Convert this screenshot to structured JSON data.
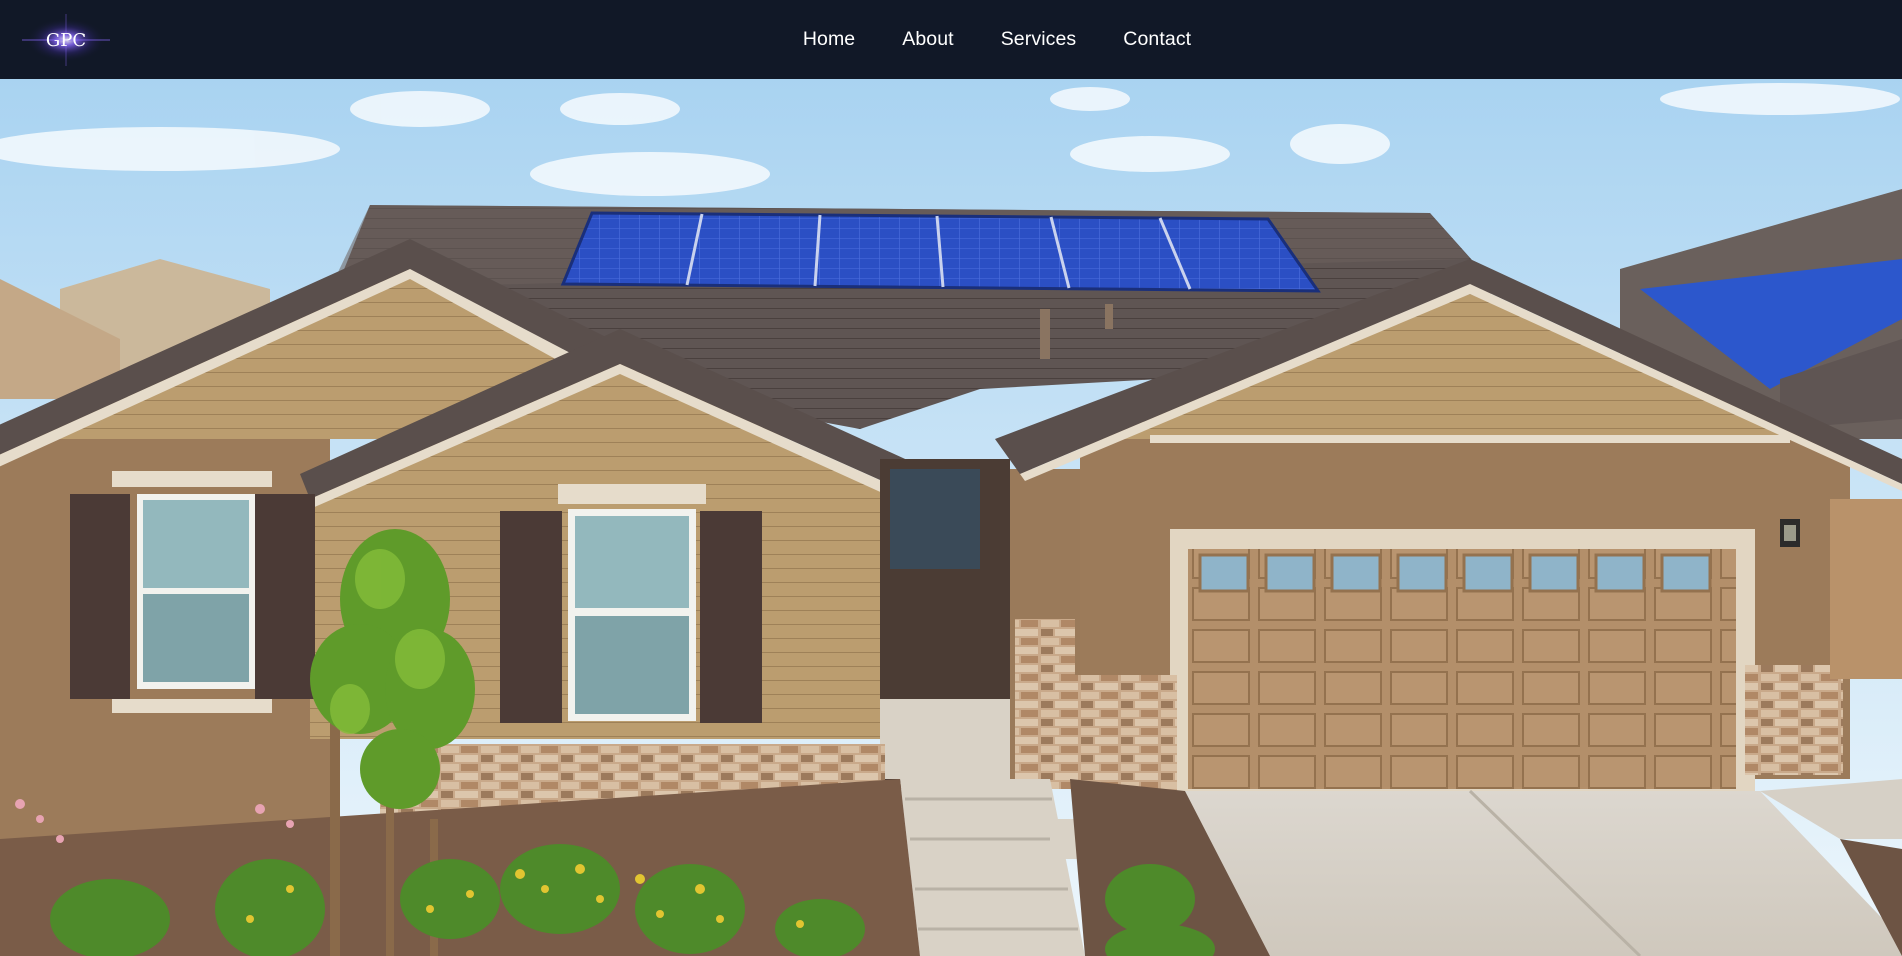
{
  "brand": {
    "logo_text": "GPC",
    "logo_glow_color": "#6d4cff"
  },
  "nav": {
    "items": [
      {
        "label": "Home"
      },
      {
        "label": "About"
      },
      {
        "label": "Services"
      },
      {
        "label": "Contact"
      }
    ]
  },
  "colors": {
    "navbar_bg": "#111827",
    "nav_text": "#ffffff",
    "sky_top": "#a9d3f1",
    "sky_bottom": "#e9f5fc",
    "roof": "#5f5553",
    "solar": "#2a4fc0",
    "wall_siding": "#b99b6d",
    "wall_stucco": "#9b7a58",
    "garage_door": "#b38f6a",
    "trim": "#e6dccb"
  },
  "hero": {
    "image_name": "house-with-solar-panels-photo"
  }
}
